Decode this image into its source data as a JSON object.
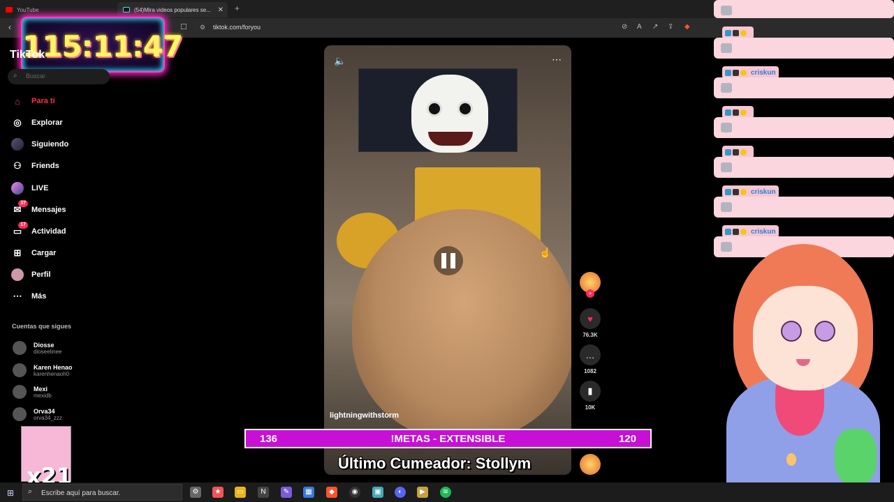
{
  "browser": {
    "tabs": [
      {
        "label": "YouTube",
        "icon": "youtube-icon"
      },
      {
        "label": "(54)Mira videos populares se...",
        "icon": "tiktok-icon"
      }
    ],
    "new_tab": "+",
    "url": "tiktok.com/foryou"
  },
  "timer": "115:11:47",
  "tiktok": {
    "logo": "TikTok",
    "search_placeholder": "Buscar",
    "nav": [
      {
        "label": "Para ti",
        "icon": "home-icon",
        "active": true
      },
      {
        "label": "Explorar",
        "icon": "compass-icon"
      },
      {
        "label": "Siguiendo",
        "icon": "following-avatar-icon"
      },
      {
        "label": "Friends",
        "icon": "friends-icon"
      },
      {
        "label": "LIVE",
        "icon": "live-icon"
      },
      {
        "label": "Mensajes",
        "icon": "messages-icon",
        "badge": "37"
      },
      {
        "label": "Actividad",
        "icon": "activity-icon",
        "badge": "17"
      },
      {
        "label": "Cargar",
        "icon": "upload-icon"
      },
      {
        "label": "Perfil",
        "icon": "profile-icon"
      },
      {
        "label": "Más",
        "icon": "more-icon"
      }
    ],
    "following_title": "Cuentas que sigues",
    "following": [
      {
        "name": "Diosse",
        "user": "dioseelinee"
      },
      {
        "name": "Karen Henao",
        "user": "karenhenaoh0"
      },
      {
        "name": "Mexi",
        "user": "mexidb"
      },
      {
        "name": "Orva34",
        "user": "orva34_zzz"
      }
    ]
  },
  "video": {
    "author": "lightningwithstorm",
    "likes": "76.3K",
    "comments": "1082",
    "saves": "10K"
  },
  "overlay": {
    "goal_left": "136",
    "goal_center": "!METAS - EXTENSIBLE",
    "goal_right": "120",
    "last_cumeador": "Último Cumeador: Stollym",
    "counter": "x21"
  },
  "chat": [
    {
      "user": "",
      "blur": true
    },
    {
      "user": "",
      "blur": true
    },
    {
      "user": "criskun",
      "blur": false
    },
    {
      "user": "",
      "blur": true
    },
    {
      "user": "",
      "blur": true
    },
    {
      "user": "criskun",
      "blur": false
    },
    {
      "user": "criskun",
      "blur": false
    }
  ],
  "taskbar": {
    "search_placeholder": "Escribe aquí para buscar."
  },
  "colors": {
    "tiktok_red": "#fe2c55",
    "goal_bar": "#c70fd6",
    "chat_bubble": "#fbd6de",
    "chat_name": "#2d7fd8"
  }
}
